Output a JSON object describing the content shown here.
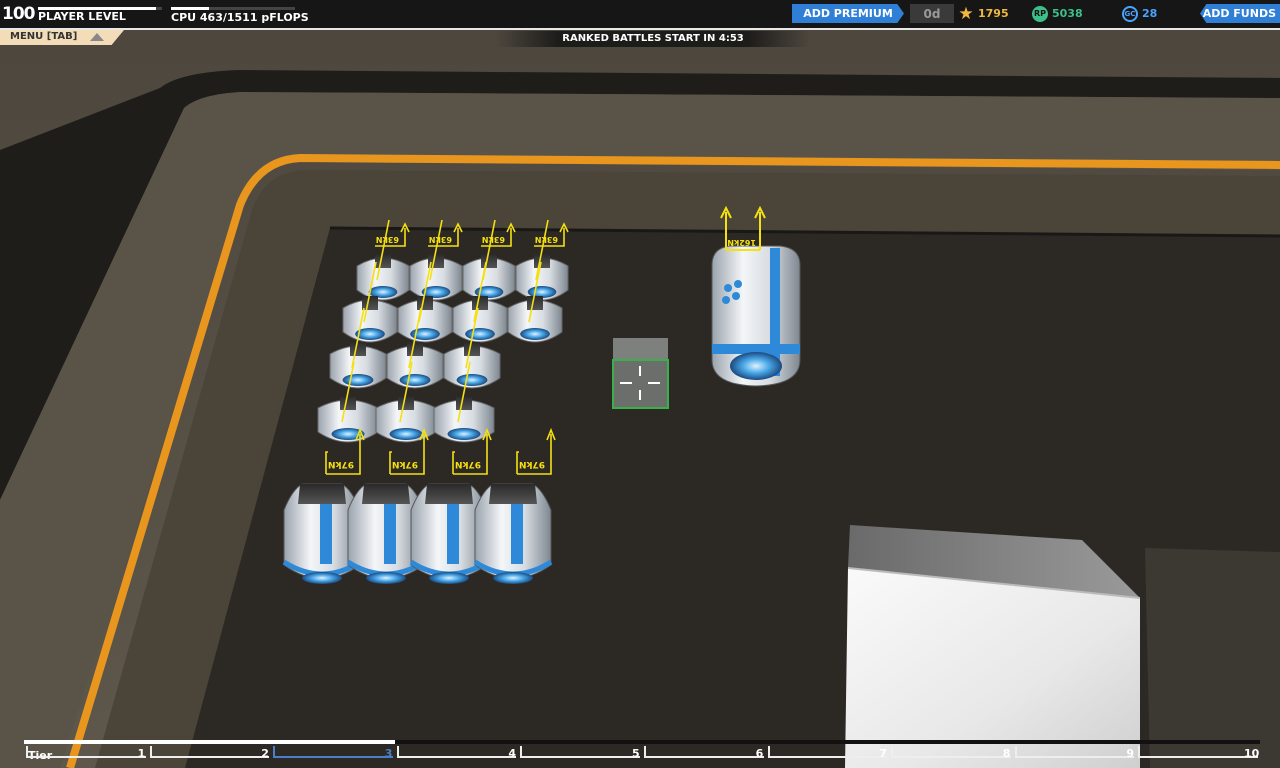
{
  "hud": {
    "player_level": "100",
    "player_level_label": "PLAYER LEVEL",
    "level_progress": 0.95,
    "cpu_label": "CPU 463/1511 pFLOPS",
    "cpu_fraction": 0.31,
    "add_premium": "ADD PREMIUM",
    "premium_days": "0d",
    "stars": "1795",
    "robot_points": "5038",
    "galaxy_coins": "28",
    "add_funds": "ADD FUNDS"
  },
  "menu": {
    "label": "MENU [TAB]"
  },
  "banner": {
    "ranked": "RANKED BATTLES START IN  4:53"
  },
  "tiers": {
    "label": "Tier",
    "numbers": [
      "1",
      "2",
      "3",
      "4",
      "5",
      "6",
      "7",
      "8",
      "9",
      "10"
    ],
    "active": "3",
    "progress": 0.3
  },
  "thruster_labels": {
    "small": "97kN",
    "top": "63kN",
    "large": "162kN"
  },
  "colors": {
    "accent_blue": "#2f7fd6",
    "track_orange": "#e8961e",
    "thrust_yellow": "#f5e010"
  }
}
